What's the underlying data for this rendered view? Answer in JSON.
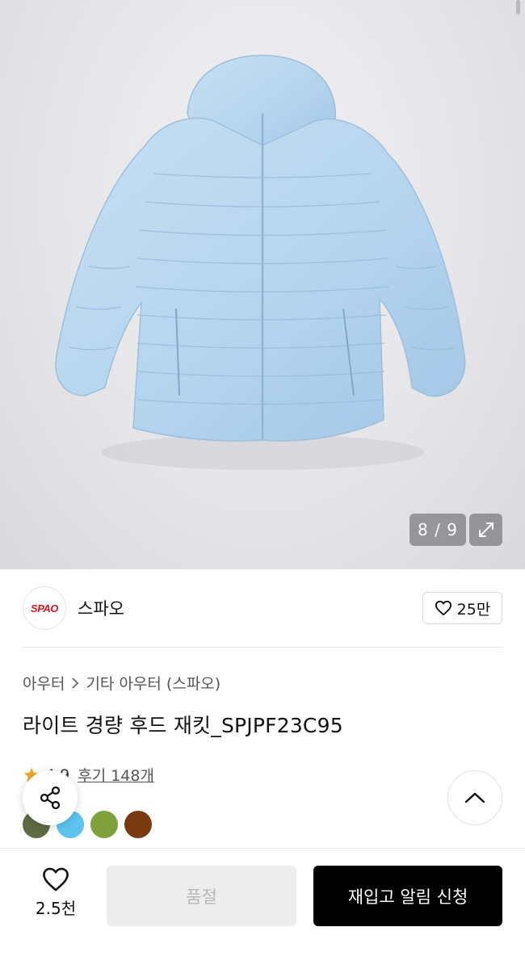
{
  "gallery": {
    "counter": "8 / 9",
    "expand_icon": "expand-icon",
    "image_subject": "light-blue-hooded-puffer-jacket"
  },
  "brand": {
    "logo_text": "SPAO",
    "name": "스파오",
    "like_count": "25만",
    "logo_color": "#d6191e"
  },
  "category": {
    "parent": "아우터",
    "child": "기타 아우터 (스파오)"
  },
  "product": {
    "title": "라이트 경량 후드 재킷_SPJPF23C95"
  },
  "rating": {
    "score": "4.9",
    "review_label": "후기 148개",
    "star_color": "#f5a623"
  },
  "colors": [
    {
      "name": "olive",
      "hex": "#5f6b45"
    },
    {
      "name": "sky-blue",
      "hex": "#5ec3ee"
    },
    {
      "name": "lime-green",
      "hex": "#7fa23c"
    },
    {
      "name": "brown",
      "hex": "#7a3a0f"
    }
  ],
  "bottom_bar": {
    "wish_count": "2.5천",
    "soldout_label": "품절",
    "restock_label": "재입고 알림 신청"
  }
}
